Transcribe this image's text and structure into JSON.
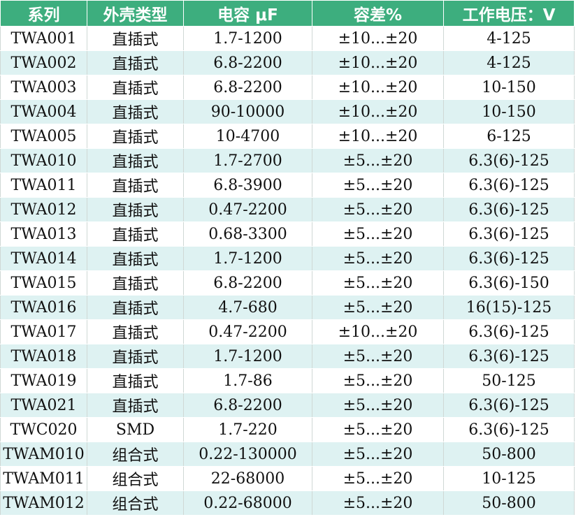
{
  "table": {
    "headers": [
      "系列",
      "外壳类型",
      "电容 μF",
      "容差%",
      "工作电压：V"
    ],
    "rows": [
      [
        "TWA001",
        "直插式",
        "1.7-1200",
        "±10...±20",
        "4-125"
      ],
      [
        "TWA002",
        "直插式",
        "6.8-2200",
        "±10...±20",
        "4-125"
      ],
      [
        "TWA003",
        "直插式",
        "6.8-2200",
        "±10...±20",
        "10-150"
      ],
      [
        "TWA004",
        "直插式",
        "90-10000",
        "±10...±20",
        "10-150"
      ],
      [
        "TWA005",
        "直插式",
        "10-4700",
        "±10...±20",
        "6-125"
      ],
      [
        "TWA010",
        "直插式",
        "1.7-2700",
        "±5...±20",
        "6.3(6)-125"
      ],
      [
        "TWA011",
        "直插式",
        "6.8-3900",
        "±5...±20",
        "6.3(6)-125"
      ],
      [
        "TWA012",
        "直插式",
        "0.47-2200",
        "±5...±20",
        "6.3(6)-125"
      ],
      [
        "TWA013",
        "直插式",
        "0.68-3300",
        "±5...±20",
        "6.3(6)-125"
      ],
      [
        "TWA014",
        "直插式",
        "1.7-1200",
        "±5...±20",
        "6.3(6)-125"
      ],
      [
        "TWA015",
        "直插式",
        "6.8-2200",
        "±5...±20",
        "6.3(6)-150"
      ],
      [
        "TWA016",
        "直插式",
        "4.7-680",
        "±5...±20",
        "16(15)-125"
      ],
      [
        "TWA017",
        "直插式",
        "0.47-2200",
        "±10...±20",
        "6.3(6)-125"
      ],
      [
        "TWA018",
        "直插式",
        "1.7-1200",
        "±5...±20",
        "6.3(6)-125"
      ],
      [
        "TWA019",
        "直插式",
        "1.7-86",
        "±5...±20",
        "50-125"
      ],
      [
        "TWA021",
        "直插式",
        "6.8-2200",
        "±5...±20",
        "6.3(6)-125"
      ],
      [
        "TWC020",
        "SMD",
        "1.7-220",
        "±5...±20",
        "6.3(6)-125"
      ],
      [
        "TWAM010",
        "组合式",
        "0.22-130000",
        "±5...±20",
        "50-800"
      ],
      [
        "TWAM011",
        "组合式",
        "22-68000",
        "±5...±20",
        "10-125"
      ],
      [
        "TWAM012",
        "组合式",
        "0.22-68000",
        "±5...±20",
        "50-800"
      ]
    ]
  },
  "colors": {
    "header_bg": "#3dae7e",
    "header_text": "#ffffff",
    "row_alt_bg": "#def2f2",
    "row_bg": "#ffffff"
  }
}
